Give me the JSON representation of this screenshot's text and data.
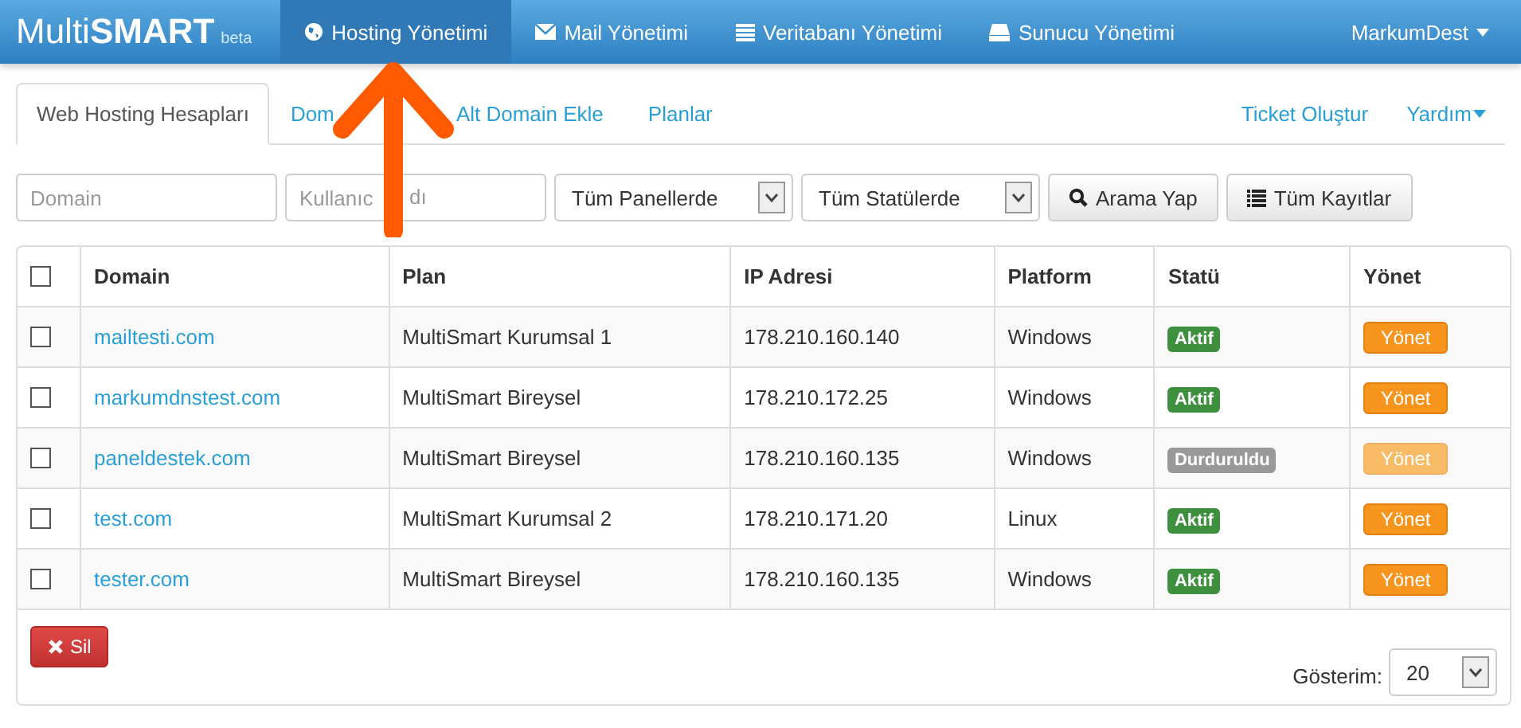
{
  "navbar": {
    "brand": {
      "main": "Multi",
      "bold": "SMART",
      "tag": "beta"
    },
    "items": [
      {
        "label": "Hosting Yönetimi",
        "selected": true
      },
      {
        "label": "Mail Yönetimi",
        "selected": false
      },
      {
        "label": "Veritabanı Yönetimi",
        "selected": false
      },
      {
        "label": "Sunucu Yönetimi",
        "selected": false
      }
    ],
    "user": "MarkumDest"
  },
  "tabs": [
    {
      "label": "Web Hosting Hesapları",
      "selected": true
    },
    {
      "label": "Dom",
      "selected": false
    },
    {
      "label": "Alt Domain Ekle",
      "selected": false
    },
    {
      "label": "Planlar",
      "selected": false
    }
  ],
  "right_links": [
    {
      "label": "Ticket Oluştur",
      "dropdown": false
    },
    {
      "label": "Yardım",
      "dropdown": true
    }
  ],
  "filters": {
    "domain": {
      "placeholder": "Domain"
    },
    "username": {
      "placeholder": "Kullanıc",
      "placeholder_tail": "dı"
    },
    "panel": {
      "value": "Tüm Panellerde"
    },
    "status": {
      "value": "Tüm Statülerde"
    },
    "search_button": "Arama Yap",
    "all_button": "Tüm Kayıtlar"
  },
  "table": {
    "select_all": {
      "checked": false
    },
    "columns": [
      "Domain",
      "Plan",
      "IP Adresi",
      "Platform",
      "Statü",
      "Yönet"
    ],
    "rows": [
      {
        "checked": false,
        "domain": "mailtesti.com",
        "plan": "MultiSmart Kurumsal 1",
        "ip": "178.210.160.140",
        "platform": "Windows",
        "status": "Aktif",
        "color": "#3e8f3e",
        "action": "Yönet",
        "disabled": false
      },
      {
        "checked": false,
        "domain": "markumdnstest.com",
        "plan": "MultiSmart Bireysel",
        "ip": "178.210.172.25",
        "platform": "Windows",
        "status": "Aktif",
        "color": "#3e8f3e",
        "action": "Yönet",
        "disabled": false
      },
      {
        "checked": false,
        "domain": "paneldestek.com",
        "plan": "MultiSmart Bireysel",
        "ip": "178.210.160.135",
        "platform": "Windows",
        "status": "Durduruldu",
        "color": "#999999",
        "action": "Yönet",
        "disabled": true
      },
      {
        "checked": false,
        "domain": "test.com",
        "plan": "MultiSmart Kurumsal 2",
        "ip": "178.210.171.20",
        "platform": "Linux",
        "status": "Aktif",
        "color": "#3e8f3e",
        "action": "Yönet",
        "disabled": false
      },
      {
        "checked": false,
        "domain": "tester.com",
        "plan": "MultiSmart Bireysel",
        "ip": "178.210.160.135",
        "platform": "Windows",
        "status": "Aktif",
        "color": "#3e8f3e",
        "action": "Yönet",
        "disabled": false
      }
    ]
  },
  "footer": {
    "delete_button": "Sil",
    "page_size_label": "Gösterim:",
    "page_size": "20"
  }
}
